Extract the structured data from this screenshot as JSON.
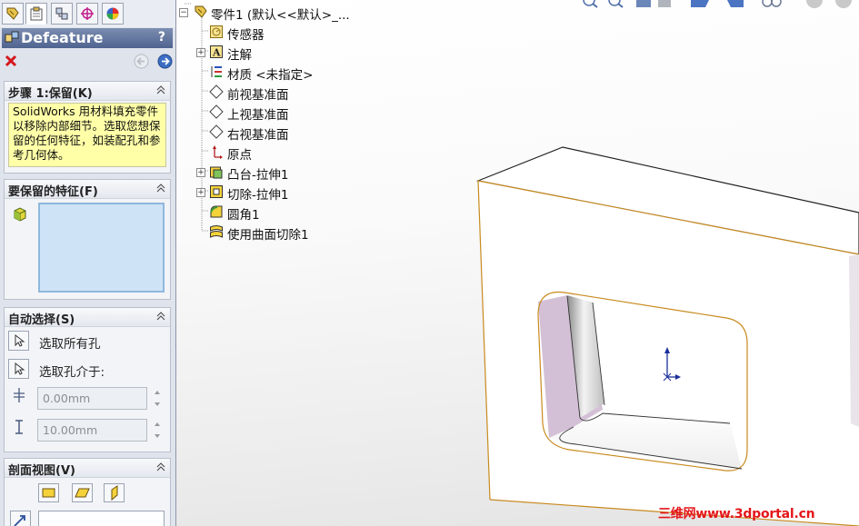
{
  "property_manager": {
    "tabs": [
      "feature-manager",
      "property-manager",
      "configuration-manager",
      "dimxpert-manager",
      "display-manager"
    ],
    "title": "Defeature",
    "help": "?",
    "step_group": {
      "title": "步骤 1:保留(K)",
      "hint": "SolidWorks 用材料填充零件以移除内部细节。选取您想保留的任何特征，如装配孔和参考几何体。"
    },
    "features_group": {
      "title": "要保留的特征(F)"
    },
    "auto_select_group": {
      "title": "自动选择(S)",
      "select_all_holes": "选取所有孔",
      "select_holes_between": "选取孔介于:",
      "min_value": "0.00mm",
      "max_value": "10.00mm"
    },
    "section_view_group": {
      "title": "剖面视图(V)"
    }
  },
  "feature_tree": {
    "root": "零件1  (默认<<默认>_...",
    "items": [
      {
        "label": "传感器",
        "expandable": false,
        "icon": "sensor-icon"
      },
      {
        "label": "注解",
        "expandable": true,
        "icon": "annotation-icon"
      },
      {
        "label": "材质 <未指定>",
        "expandable": false,
        "icon": "material-icon"
      },
      {
        "label": "前视基准面",
        "expandable": false,
        "icon": "plane-icon"
      },
      {
        "label": "上视基准面",
        "expandable": false,
        "icon": "plane-icon"
      },
      {
        "label": "右视基准面",
        "expandable": false,
        "icon": "plane-icon"
      },
      {
        "label": "原点",
        "expandable": false,
        "icon": "origin-icon"
      },
      {
        "label": "凸台-拉伸1",
        "expandable": true,
        "icon": "boss-extrude-icon"
      },
      {
        "label": "切除-拉伸1",
        "expandable": true,
        "icon": "cut-extrude-icon"
      },
      {
        "label": "圆角1",
        "expandable": false,
        "icon": "fillet-icon"
      },
      {
        "label": "使用曲面切除1",
        "expandable": false,
        "icon": "surface-cut-icon"
      }
    ]
  },
  "watermark": "三维网www.3dportal.cn",
  "colors": {
    "title_bar": "#5a6d98",
    "hint_background": "#ffffa8",
    "selection_box": "#cfe3f7",
    "model_edge": "#c88a1e",
    "hole_wall": "#d3bfd6",
    "watermark": "#e4161a"
  }
}
